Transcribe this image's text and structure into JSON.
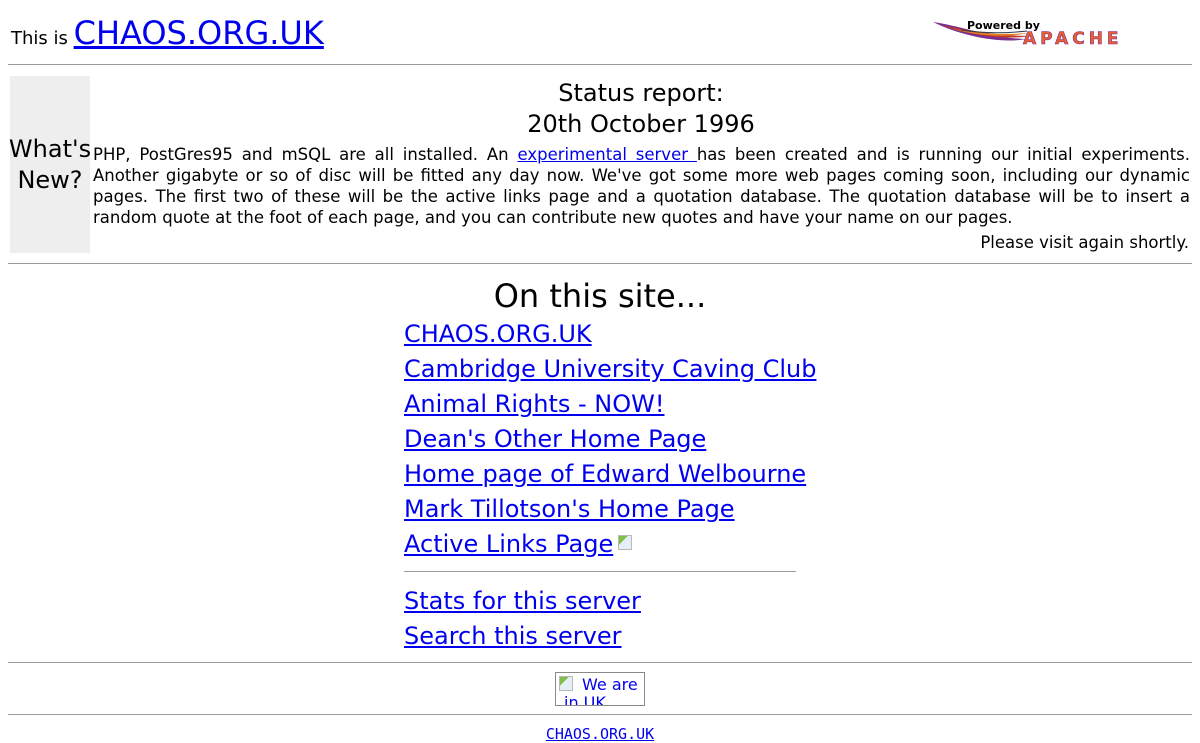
{
  "header": {
    "prefix": "This is",
    "site_link": "CHAOS.ORG.UK",
    "apache_logo": {
      "top_text": "Powered by",
      "main_text": "APACHE",
      "icon": "apache-feather-icon"
    }
  },
  "whats_new": {
    "line1": "What's",
    "line2": "New?"
  },
  "status": {
    "title": "Status report:",
    "date": "20th October 1996",
    "body_before": "PHP, PostGres95 and mSQL are all installed. An ",
    "link": "experimental server ",
    "body_after": "has been created and is running our initial experiments. Another gigabyte or so of disc will be fitted any day now. We've got some more web pages coming soon, including our dynamic pages. The first two of these will be the active links page and a quotation database. The quotation database will be to insert a random quote at the foot of each page, and you can contribute new quotes and have your name on our pages.",
    "visit": "Please visit again shortly."
  },
  "site": {
    "heading": "On this site...",
    "links": [
      "CHAOS.ORG.UK",
      "Cambridge University Caving Club",
      "Animal Rights - NOW!",
      "Dean's Other Home Page",
      "Home page of Edward Welbourne",
      "Mark Tillotson's Home Page",
      "Active Links Page"
    ],
    "server_links": [
      "Stats for this server",
      "Search this server"
    ]
  },
  "badge": {
    "alt_text": "We are in UK Local"
  },
  "footer": {
    "link": "CHAOS.ORG.UK"
  },
  "colors": {
    "link": "#0000ee",
    "cell_background": "#eeeeee",
    "rule": "#9a9a9a"
  }
}
